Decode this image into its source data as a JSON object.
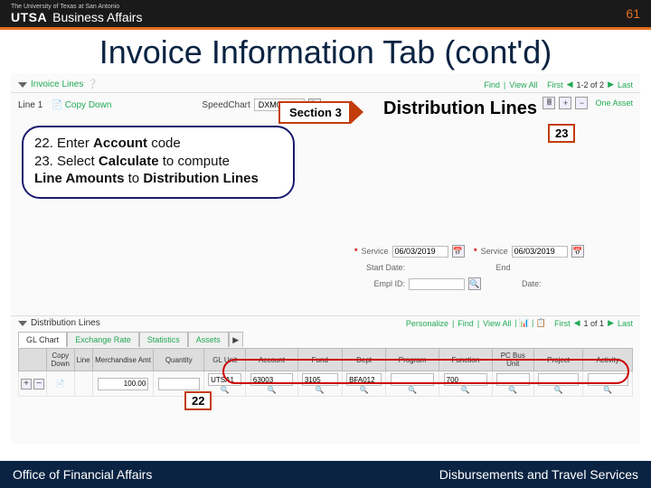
{
  "header": {
    "subtitle": "The University of Texas at San Antonio",
    "logo_left": "UTSA",
    "logo_right": "Business Affairs",
    "page_number": "61"
  },
  "title": "Invoice Information Tab (cont'd)",
  "section_label": "Section 3",
  "dist_label": "Distribution Lines",
  "callout": {
    "line1_prefix": "22. Enter ",
    "line1_bold": "Account",
    "line1_suffix": " code",
    "line2_prefix": "23. Select ",
    "line2_bold": "Calculate",
    "line2_mid": " to compute ",
    "line3_bold1": "Line Amounts",
    "line3_mid": " to ",
    "line3_bold2": "Distribution Lines"
  },
  "markers": {
    "m22": "22",
    "m23": "23"
  },
  "app": {
    "invoice_lines_label": "Invoice Lines",
    "toprow_find": "Find",
    "toprow_viewall": "View All",
    "toprow_first": "First",
    "toprow_count": "1-2 of 2",
    "toprow_last": "Last",
    "line_label": "Line",
    "line_value": "1",
    "copy_down": "Copy Down",
    "speedchart_label": "SpeedChart",
    "speedchart_value": "DXM024",
    "one_asset": "One Asset",
    "service_label": "Service",
    "service_value": "06/03/2019",
    "service2_value": "06/03/2019",
    "start_date_label": "Start Date:",
    "end_label": "End",
    "empl_label": "Empl ID:",
    "date_label": "Date:",
    "dist_lines_label": "Distribution Lines",
    "dist_personalize": "Personalize",
    "dist_find": "Find",
    "dist_viewall": "View All",
    "dist_first": "First",
    "dist_count": "1 of 1",
    "dist_last": "Last",
    "tabs": {
      "gl": "GL Chart",
      "ex": "Exchange Rate",
      "st": "Statistics",
      "as": "Assets"
    },
    "cols": {
      "copy_down": "Copy Down",
      "line": "Line",
      "merch": "Merchandise Amt",
      "qty": "Quantity",
      "gl_unit": "GL Unit",
      "account": "Account",
      "fund": "Fund",
      "dept": "Dept",
      "program": "Program",
      "function": "Function",
      "pc_bus": "PC Bus Unit",
      "project": "Project",
      "activity": "Activity"
    },
    "rowvals": {
      "merch": "100.00",
      "gl_unit": "UTSA1",
      "account": "63003",
      "fund": "3105",
      "dept": "BFA012",
      "function": "700"
    }
  },
  "footer": {
    "left": "Office of Financial Affairs",
    "right": "Disbursements and Travel Services"
  }
}
